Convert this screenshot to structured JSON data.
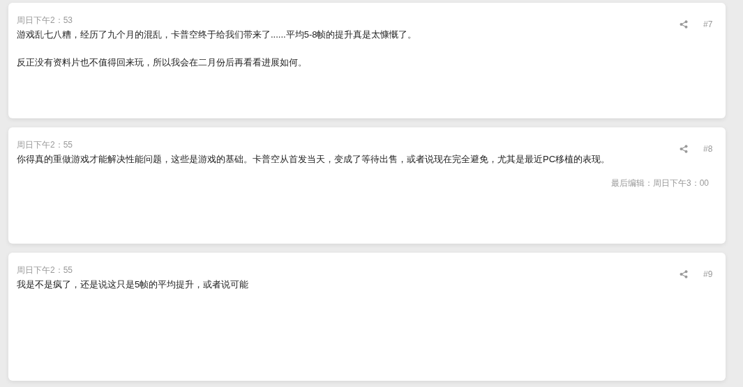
{
  "posts": [
    {
      "time": "周日下午2：53",
      "number": "#7",
      "paragraphs": [
        "游戏乱七八糟，经历了九个月的混乱，卡普空终于给我们带来了......平均5-8帧的提升真是太慷慨了。",
        "反正没有资料片也不值得回来玩，所以我会在二月份后再看看进展如何。"
      ]
    },
    {
      "time": "周日下午2：55",
      "number": "#8",
      "paragraphs": [
        "你得真的重做游戏才能解决性能问题，这些是游戏的基础。卡普空从首发当天，变成了等待出售，或者说现在完全避免，尤其是最近PC移植的表现。"
      ],
      "edited": "最后编辑：周日下午3：00"
    },
    {
      "time": "周日下午2：55",
      "number": "#9",
      "paragraphs": [
        "我是不是疯了，还是说这只是5帧的平均提升，或者说可能"
      ]
    }
  ]
}
